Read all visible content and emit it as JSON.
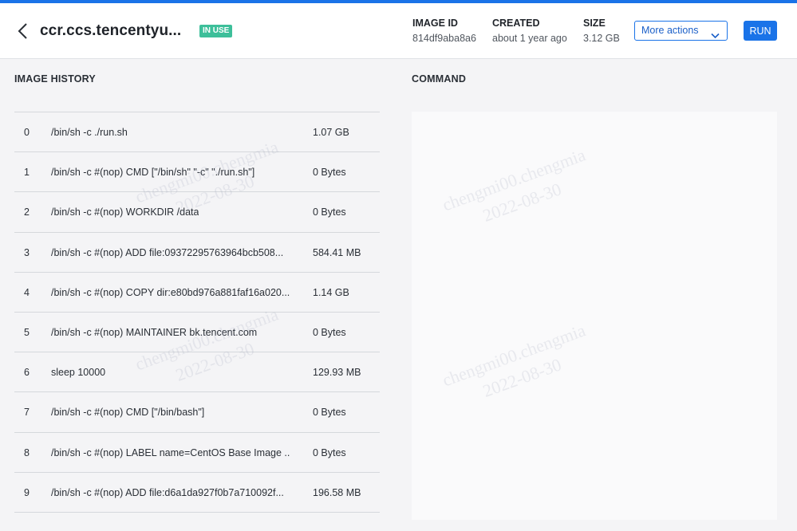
{
  "header": {
    "title": "ccr.ccs.tencentyu...",
    "badge": "IN USE",
    "meta": [
      {
        "label": "IMAGE ID",
        "value": "814df9aba8a6"
      },
      {
        "label": "CREATED",
        "value": "about 1 year ago"
      },
      {
        "label": "SIZE",
        "value": "3.12 GB"
      }
    ],
    "more_actions_label": "More actions",
    "run_label": "RUN"
  },
  "history": {
    "title": "IMAGE HISTORY",
    "rows": [
      {
        "idx": "0",
        "cmd": "/bin/sh -c ./run.sh",
        "size": "1.07 GB"
      },
      {
        "idx": "1",
        "cmd": "/bin/sh -c #(nop) CMD [\"/bin/sh\" \"-c\" \"./run.sh\"]",
        "size": "0 Bytes"
      },
      {
        "idx": "2",
        "cmd": "/bin/sh -c #(nop) WORKDIR /data",
        "size": "0 Bytes"
      },
      {
        "idx": "3",
        "cmd": "/bin/sh -c #(nop) ADD file:09372295763964bcb508...",
        "size": "584.41 MB"
      },
      {
        "idx": "4",
        "cmd": "/bin/sh -c #(nop) COPY dir:e80bd976a881faf16a020...",
        "size": "1.14 GB"
      },
      {
        "idx": "5",
        "cmd": "/bin/sh -c #(nop) MAINTAINER bk.tencent.com",
        "size": "0 Bytes"
      },
      {
        "idx": "6",
        "cmd": "sleep 10000",
        "size": "129.93 MB"
      },
      {
        "idx": "7",
        "cmd": "/bin/sh -c #(nop) CMD [\"/bin/bash\"]",
        "size": "0 Bytes"
      },
      {
        "idx": "8",
        "cmd": "/bin/sh -c #(nop) LABEL name=CentOS Base Image ...",
        "size": "0 Bytes"
      },
      {
        "idx": "9",
        "cmd": "/bin/sh -c #(nop) ADD file:d6a1da927f0b7a710092f...",
        "size": "196.58 MB"
      }
    ]
  },
  "command": {
    "title": "COMMAND"
  },
  "watermark": {
    "line1": "chengmi00.chengmia",
    "line2": "2022-08-30"
  },
  "colors": {
    "accent": "#1a73e8",
    "badge": "#3dbf9a"
  }
}
